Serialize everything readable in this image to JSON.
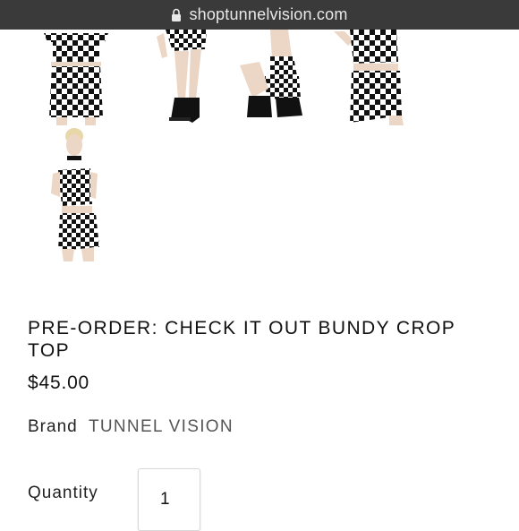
{
  "browser": {
    "domain": "shoptunnelvision.com",
    "lock_icon": "lock-icon"
  },
  "gallery": {
    "images": [
      {
        "name": "product-thumbnail-front"
      },
      {
        "name": "product-thumbnail-legs"
      },
      {
        "name": "product-thumbnail-crouch"
      },
      {
        "name": "product-thumbnail-side"
      },
      {
        "name": "product-thumbnail-full"
      }
    ]
  },
  "product": {
    "title": "PRE-ORDER: CHECK IT OUT BUNDY CROP TOP",
    "price": "$45.00",
    "brand_label": "Brand",
    "brand_name": "TUNNEL VISION",
    "quantity_label": "Quantity",
    "quantity_value": "1"
  },
  "colors": {
    "url_bar": "#3a3a3a",
    "text": "#111111",
    "brand_link": "#555555"
  }
}
